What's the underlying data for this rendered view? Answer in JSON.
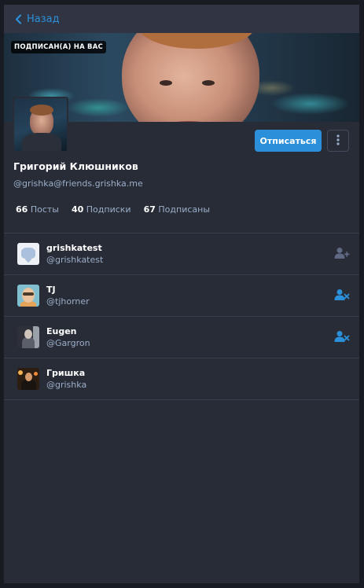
{
  "nav": {
    "back_label": "Назад"
  },
  "header": {
    "follows_you_badge": "ПОДПИСАН(А) НА ВАС",
    "unfollow_label": "Отписаться"
  },
  "profile": {
    "display_name": "Григорий Клюшников",
    "acct": "@grishka@friends.grishka.me"
  },
  "counts": [
    {
      "value": "66",
      "label": "Посты"
    },
    {
      "value": "40",
      "label": "Подписки"
    },
    {
      "value": "67",
      "label": "Подписаны"
    }
  ],
  "accounts": [
    {
      "display_name": "grishkatest",
      "username": "@grishkatest",
      "action_icon": "follow-user-icon",
      "action_color": "#606984"
    },
    {
      "display_name": "TJ",
      "username": "@tjhorner",
      "action_icon": "unfollow-user-icon",
      "action_color": "#2b90d9"
    },
    {
      "display_name": "Eugen",
      "username": "@Gargron",
      "action_icon": "unfollow-user-icon",
      "action_color": "#2b90d9"
    },
    {
      "display_name": "Гришка",
      "username": "@grishka",
      "action_icon": "",
      "action_color": ""
    }
  ],
  "colors": {
    "accent": "#2b90d9",
    "background": "#282c37",
    "muted": "#606984"
  }
}
